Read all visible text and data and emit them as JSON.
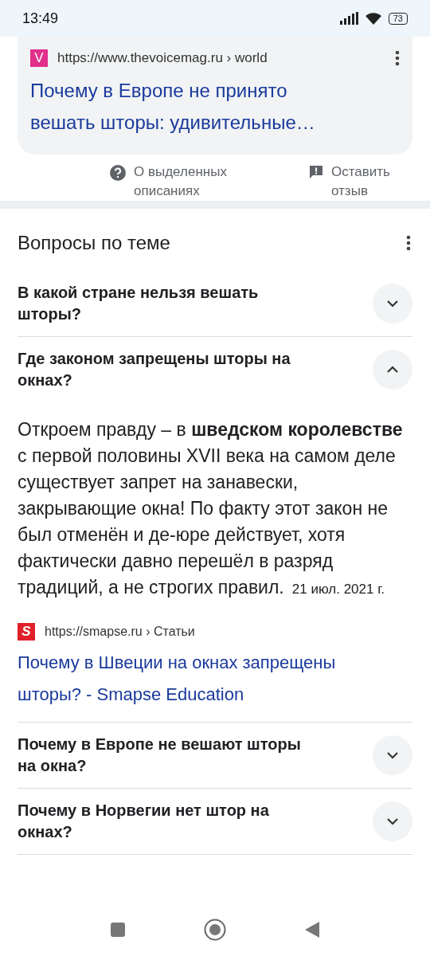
{
  "status_bar": {
    "time": "13:49",
    "battery": "73"
  },
  "result_card": {
    "favicon": "V",
    "url": "https://www.thevoicemag.ru › world",
    "title": "Почему в Европе не принято вешать шторы: удивительные…"
  },
  "footer_links": [
    {
      "kind": "help",
      "text": "О выделенных описаниях"
    },
    {
      "kind": "feedback",
      "text": "Оставить отзыв"
    }
  ],
  "related_questions": {
    "title": "Вопросы по теме",
    "items": [
      {
        "question": "В какой стране нельзя вешать шторы?",
        "expanded": false
      },
      {
        "question": "Где законом запрещены шторы на окнах?",
        "expanded": true,
        "answer": {
          "text": "Откроем правду – в **шведском королевстве** с первой половины XVII века на самом деле существует запрет на занавески, закрывающие окна! По факту этот закон не был отменён и де-юре действует, хотя фактически давно перешёл в разряд традиций, а не строгих правил.",
          "date": "21 июл. 2021 г.",
          "source": {
            "favicon": "S",
            "url": "https://smapse.ru › Статьи",
            "title": "Почему в Швеции на окнах запрещены шторы? - Smapse Education"
          }
        }
      },
      {
        "question": "Почему в Европе не вешают шторы на окна?",
        "expanded": false
      },
      {
        "question": "Почему в Норвегии нет штор на окнах?",
        "expanded": false
      }
    ]
  }
}
